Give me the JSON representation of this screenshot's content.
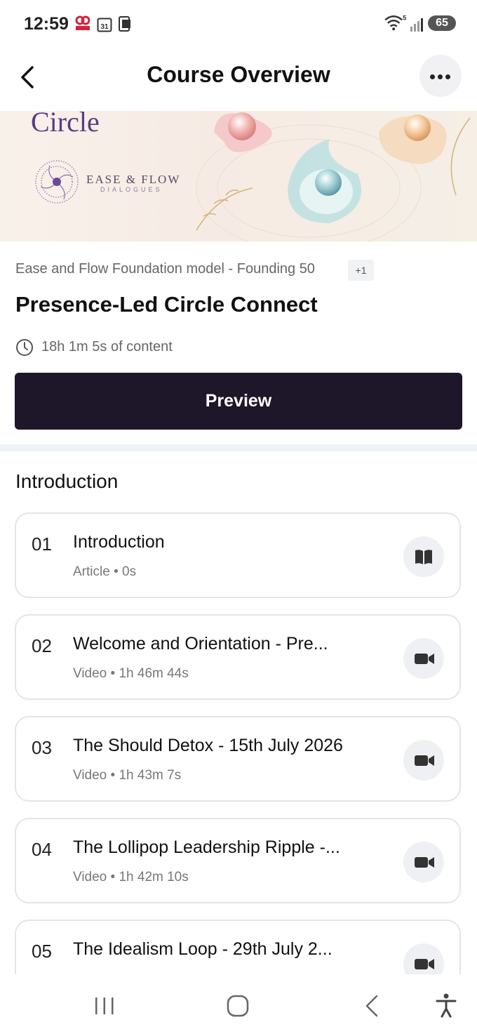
{
  "status_bar": {
    "time": "12:59",
    "battery": "65",
    "icons": [
      "hood-app-icon",
      "calendar-icon",
      "device-icon",
      "wifi-icon",
      "signal-icon",
      "battery-icon"
    ],
    "calendar_day": "31",
    "wifi_badge": "5"
  },
  "header": {
    "title": "Course Overview",
    "back_icon": "chevron-left-icon",
    "more_icon": "more-dots-icon"
  },
  "banner": {
    "heading": "Circle",
    "brand": "EASE & FLOW",
    "brand_sub": "DIALOGUES"
  },
  "course": {
    "category": "Ease and Flow Foundation model - Founding 50",
    "extra_badge": "+1",
    "title": "Presence-Led Circle Connect",
    "duration": "18h 1m 5s of content",
    "preview_label": "Preview"
  },
  "section": {
    "title": "Introduction",
    "lessons": [
      {
        "num": "01",
        "title": "Introduction",
        "meta": "Article • 0s",
        "icon": "book-icon"
      },
      {
        "num": "02",
        "title": "Welcome and Orientation - Pre...",
        "meta": "Video • 1h 46m 44s",
        "icon": "video-camera-icon"
      },
      {
        "num": "03",
        "title": "The Should Detox - 15th July 2026",
        "meta": "Video • 1h 43m 7s",
        "icon": "video-camera-icon"
      },
      {
        "num": "04",
        "title": "The Lollipop Leadership Ripple -...",
        "meta": "Video • 1h 42m 10s",
        "icon": "video-camera-icon"
      },
      {
        "num": "05",
        "title": "The Idealism Loop - 29th July 2...",
        "meta": "",
        "icon": "video-camera-icon"
      }
    ]
  },
  "nav_bar": {
    "items": [
      "recent-apps-icon",
      "home-icon",
      "back-icon",
      "accessibility-icon"
    ]
  }
}
